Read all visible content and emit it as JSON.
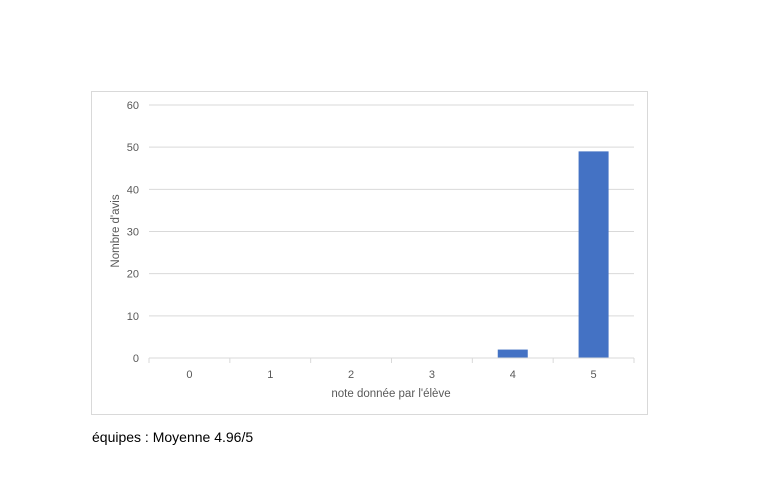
{
  "chart_data": {
    "type": "bar",
    "categories": [
      "0",
      "1",
      "2",
      "3",
      "4",
      "5"
    ],
    "values": [
      0,
      0,
      0,
      0,
      2,
      49
    ],
    "xlabel": "note donnée par l'élève",
    "ylabel": "Nombre d'avis",
    "ylim": [
      0,
      60
    ],
    "yticks": [
      0,
      10,
      20,
      30,
      40,
      50,
      60
    ],
    "grid": true,
    "legend": "none",
    "bar_color": "#4472C4",
    "grid_color": "#d9d9d9"
  },
  "caption": "équipes : Moyenne 4.96/5"
}
